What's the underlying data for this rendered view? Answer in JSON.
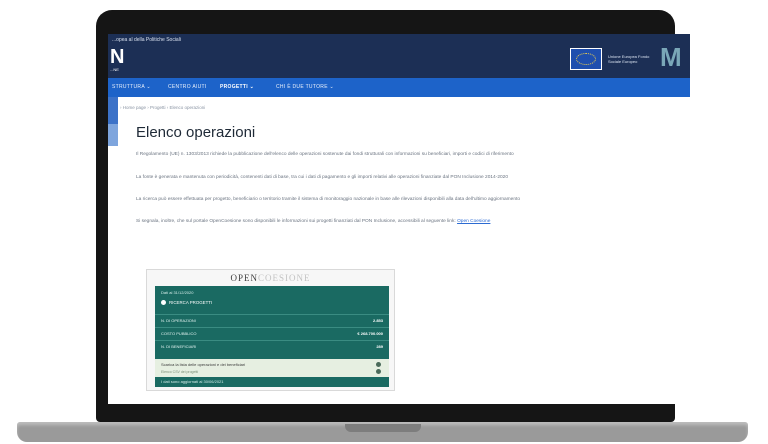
{
  "header": {
    "top_text": "...opea al della Politiche Sociali",
    "logo": "N",
    "logo_sub": "...NE",
    "eu_text": "Unione Europea Fondo Sociale Europeo"
  },
  "nav": {
    "items": [
      "STRUTTURA ⌄",
      "CENTRO AIUTI",
      "PROGETTI ⌄",
      "CHI È DUE TUTORE ⌄"
    ]
  },
  "breadcrumb": "› Home page  › Progetti  › Elenco operazioni",
  "page": {
    "title": "Elenco operazioni",
    "paragraphs": [
      "Il Regolamento (UE) n. 1303/2013 richiede la pubblicazione dell'elenco delle operazioni sostenute dai fondi strutturali con informazioni su beneficiari, importi e codici di riferimento",
      "La fonte è generata e mantenuta con periodicità, contenenti dati di base, tra cui i dati di pagamento e gli importi relativi alle operazioni finanziate dal PON Inclusione 2014-2020",
      "La ricerca può essere effettuata per progetto, beneficiario o territorio tramite il sistema di monitoraggio nazionale in base alle rilevazioni disponibili alla data dell'ultimo aggiornamento",
      "Si segnala, inoltre, che sul portale OpenCoesione sono disponibili le informazioni sui progetti finanziati dal PON Inclusione, accessibili al seguente link:"
    ],
    "link_label": "Open Coesione"
  },
  "widget": {
    "title_bold": "OPEN",
    "title_thin": "COESIONE",
    "date": "Dati al 31/12/2020",
    "search_label": "RICERCA PROGETTI",
    "rows": [
      {
        "label": "N. DI OPERAZIONI",
        "value": "2.853"
      },
      {
        "label": "COSTO PUBBLICO",
        "value": "€ 268.700.000"
      },
      {
        "label": "N. DI BENEFICIARI",
        "value": "289"
      }
    ],
    "light_line1": "Scarica la lista delle operazioni e dei beneficiari",
    "light_line2": "Elenco CSV dei progetti",
    "footer": "I dati sono aggiornati al 30/06/2021"
  },
  "colors": {
    "header": "#1c2f55",
    "nav": "#1d63c9",
    "widget_green": "#1a6a62"
  }
}
